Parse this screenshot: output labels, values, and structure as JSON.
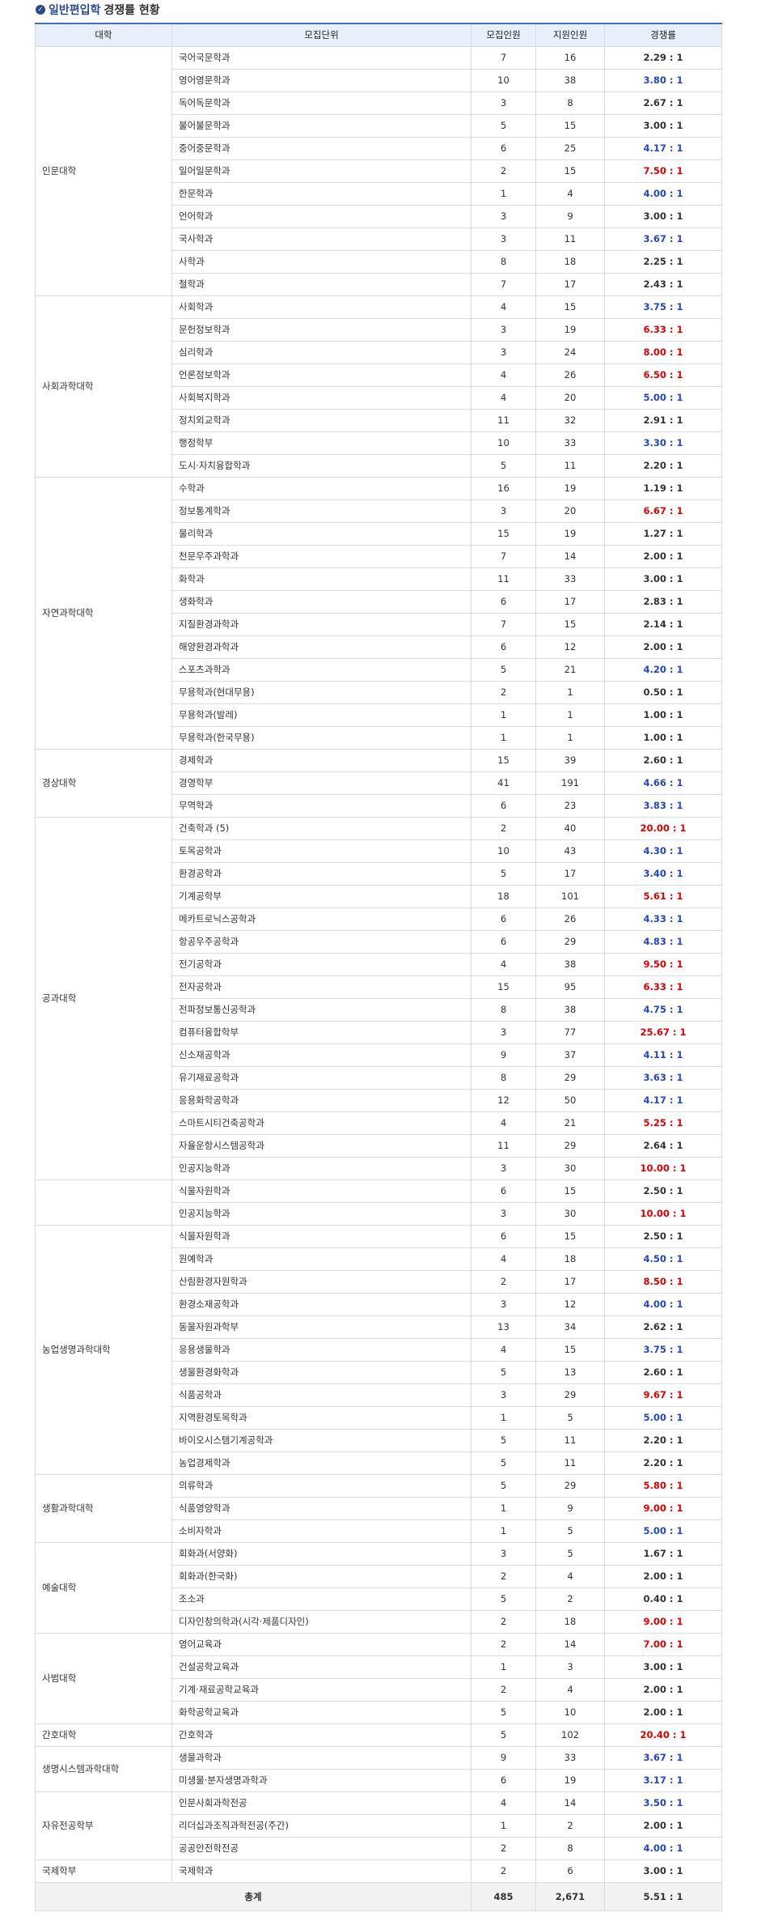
{
  "title": {
    "icon": "check-circle-icon",
    "part1": "일반편입학",
    "part2": "경쟁률 현황"
  },
  "headers": [
    "대학",
    "모집단위",
    "모집인원",
    "지원인원",
    "경쟁률"
  ],
  "colors": {
    "normal": "#222222",
    "blue": "#2246c7",
    "red": "#e00000",
    "header_bg": "#e8effa",
    "header_border": "#3f6fc4"
  },
  "groups": [
    {
      "college": "인문대학",
      "rows": [
        [
          "국어국문학과",
          "7",
          "16",
          "2.29 : 1",
          "normal"
        ],
        [
          "영어영문학과",
          "10",
          "38",
          "3.80 : 1",
          "blue"
        ],
        [
          "독어독문학과",
          "3",
          "8",
          "2.67 : 1",
          "normal"
        ],
        [
          "불어불문학과",
          "5",
          "15",
          "3.00 : 1",
          "normal"
        ],
        [
          "중어중문학과",
          "6",
          "25",
          "4.17 : 1",
          "blue"
        ],
        [
          "일어일문학과",
          "2",
          "15",
          "7.50 : 1",
          "red"
        ],
        [
          "한문학과",
          "1",
          "4",
          "4.00 : 1",
          "blue"
        ],
        [
          "언어학과",
          "3",
          "9",
          "3.00 : 1",
          "normal"
        ],
        [
          "국사학과",
          "3",
          "11",
          "3.67 : 1",
          "blue"
        ],
        [
          "사학과",
          "8",
          "18",
          "2.25 : 1",
          "normal"
        ],
        [
          "철학과",
          "7",
          "17",
          "2.43 : 1",
          "normal"
        ]
      ]
    },
    {
      "college": "사회과학대학",
      "rows": [
        [
          "사회학과",
          "4",
          "15",
          "3.75 : 1",
          "blue"
        ],
        [
          "문헌정보학과",
          "3",
          "19",
          "6.33 : 1",
          "red"
        ],
        [
          "심리학과",
          "3",
          "24",
          "8.00 : 1",
          "red"
        ],
        [
          "언론정보학과",
          "4",
          "26",
          "6.50 : 1",
          "red"
        ],
        [
          "사회복지학과",
          "4",
          "20",
          "5.00 : 1",
          "blue"
        ],
        [
          "정치외교학과",
          "11",
          "32",
          "2.91 : 1",
          "normal"
        ],
        [
          "행정학부",
          "10",
          "33",
          "3.30 : 1",
          "blue"
        ],
        [
          "도시·자치융합학과",
          "5",
          "11",
          "2.20 : 1",
          "normal"
        ]
      ]
    },
    {
      "college": "자연과학대학",
      "rows": [
        [
          "수학과",
          "16",
          "19",
          "1.19 : 1",
          "normal"
        ],
        [
          "정보통계학과",
          "3",
          "20",
          "6.67 : 1",
          "red"
        ],
        [
          "물리학과",
          "15",
          "19",
          "1.27 : 1",
          "normal"
        ],
        [
          "천문우주과학과",
          "7",
          "14",
          "2.00 : 1",
          "normal"
        ],
        [
          "화학과",
          "11",
          "33",
          "3.00 : 1",
          "normal"
        ],
        [
          "생화학과",
          "6",
          "17",
          "2.83 : 1",
          "normal"
        ],
        [
          "지질환경과학과",
          "7",
          "15",
          "2.14 : 1",
          "normal"
        ],
        [
          "해양환경과학과",
          "6",
          "12",
          "2.00 : 1",
          "normal"
        ],
        [
          "스포츠과학과",
          "5",
          "21",
          "4.20 : 1",
          "blue"
        ],
        [
          "무용학과(현대무용)",
          "2",
          "1",
          "0.50 : 1",
          "normal"
        ],
        [
          "무용학과(발레)",
          "1",
          "1",
          "1.00 : 1",
          "normal"
        ],
        [
          "무용학과(한국무용)",
          "1",
          "1",
          "1.00 : 1",
          "normal"
        ]
      ]
    },
    {
      "college": "경상대학",
      "rows": [
        [
          "경제학과",
          "15",
          "39",
          "2.60 : 1",
          "normal"
        ],
        [
          "경영학부",
          "41",
          "191",
          "4.66 : 1",
          "blue"
        ],
        [
          "무역학과",
          "6",
          "23",
          "3.83 : 1",
          "blue"
        ]
      ]
    },
    {
      "college": "공과대학",
      "rows": [
        [
          "건축학과 (5)",
          "2",
          "40",
          "20.00 : 1",
          "red"
        ],
        [
          "토목공학과",
          "10",
          "43",
          "4.30 : 1",
          "blue"
        ],
        [
          "환경공학과",
          "5",
          "17",
          "3.40 : 1",
          "blue"
        ],
        [
          "기계공학부",
          "18",
          "101",
          "5.61 : 1",
          "red"
        ],
        [
          "메카트로닉스공학과",
          "6",
          "26",
          "4.33 : 1",
          "blue"
        ],
        [
          "항공우주공학과",
          "6",
          "29",
          "4.83 : 1",
          "blue"
        ],
        [
          "전기공학과",
          "4",
          "38",
          "9.50 : 1",
          "red"
        ],
        [
          "전자공학과",
          "15",
          "95",
          "6.33 : 1",
          "red"
        ],
        [
          "전파정보통신공학과",
          "8",
          "38",
          "4.75 : 1",
          "blue"
        ],
        [
          "컴퓨터융합학부",
          "3",
          "77",
          "25.67 : 1",
          "red"
        ],
        [
          "신소재공학과",
          "9",
          "37",
          "4.11 : 1",
          "blue"
        ],
        [
          "유기재료공학과",
          "8",
          "29",
          "3.63 : 1",
          "blue"
        ],
        [
          "응용화학공학과",
          "12",
          "50",
          "4.17 : 1",
          "blue"
        ],
        [
          "스마트시티건축공학과",
          "4",
          "21",
          "5.25 : 1",
          "red"
        ],
        [
          "자율운항시스템공학과",
          "11",
          "29",
          "2.64 : 1",
          "normal"
        ],
        [
          "인공지능학과",
          "3",
          "30",
          "10.00 : 1",
          "red"
        ]
      ]
    },
    {
      "college": "",
      "rows": [
        [
          "식물자원학과",
          "6",
          "15",
          "2.50 : 1",
          "normal"
        ],
        [
          "인공지능학과",
          "3",
          "30",
          "10.00 : 1",
          "red"
        ]
      ]
    },
    {
      "college": "농업생명과학대학",
      "rows": [
        [
          "식물자원학과",
          "6",
          "15",
          "2.50 : 1",
          "normal"
        ],
        [
          "원예학과",
          "4",
          "18",
          "4.50 : 1",
          "blue"
        ],
        [
          "산림환경자원학과",
          "2",
          "17",
          "8.50 : 1",
          "red"
        ],
        [
          "환경소재공학과",
          "3",
          "12",
          "4.00 : 1",
          "blue"
        ],
        [
          "동물자원과학부",
          "13",
          "34",
          "2.62 : 1",
          "normal"
        ],
        [
          "응용생물학과",
          "4",
          "15",
          "3.75 : 1",
          "blue"
        ],
        [
          "생물환경화학과",
          "5",
          "13",
          "2.60 : 1",
          "normal"
        ],
        [
          "식품공학과",
          "3",
          "29",
          "9.67 : 1",
          "red"
        ],
        [
          "지역환경토목학과",
          "1",
          "5",
          "5.00 : 1",
          "blue"
        ],
        [
          "바이오시스템기계공학과",
          "5",
          "11",
          "2.20 : 1",
          "normal"
        ],
        [
          "농업경제학과",
          "5",
          "11",
          "2.20 : 1",
          "normal"
        ]
      ]
    },
    {
      "college": "생활과학대학",
      "rows": [
        [
          "의류학과",
          "5",
          "29",
          "5.80 : 1",
          "red"
        ],
        [
          "식품영양학과",
          "1",
          "9",
          "9.00 : 1",
          "red"
        ],
        [
          "소비자학과",
          "1",
          "5",
          "5.00 : 1",
          "blue"
        ]
      ]
    },
    {
      "college": "예술대학",
      "rows": [
        [
          "회화과(서양화)",
          "3",
          "5",
          "1.67 : 1",
          "normal"
        ],
        [
          "회화과(한국화)",
          "2",
          "4",
          "2.00 : 1",
          "normal"
        ],
        [
          "조소과",
          "5",
          "2",
          "0.40 : 1",
          "normal"
        ],
        [
          "디자인창의학과(시각·제품디자인)",
          "2",
          "18",
          "9.00 : 1",
          "red"
        ]
      ]
    },
    {
      "college": "사범대학",
      "rows": [
        [
          "영어교육과",
          "2",
          "14",
          "7.00 : 1",
          "red"
        ],
        [
          "건설공학교육과",
          "1",
          "3",
          "3.00 : 1",
          "normal"
        ],
        [
          "기계·재료공학교육과",
          "2",
          "4",
          "2.00 : 1",
          "normal"
        ],
        [
          "화학공학교육과",
          "5",
          "10",
          "2.00 : 1",
          "normal"
        ]
      ]
    },
    {
      "college": "간호대학",
      "rows": [
        [
          "간호학과",
          "5",
          "102",
          "20.40 : 1",
          "red"
        ]
      ]
    },
    {
      "college": "생명시스템과학대학",
      "rows": [
        [
          "생물과학과",
          "9",
          "33",
          "3.67 : 1",
          "blue"
        ],
        [
          "미생물·분자생명과학과",
          "6",
          "19",
          "3.17 : 1",
          "blue"
        ]
      ]
    },
    {
      "college": "자유전공학부",
      "rows": [
        [
          "인문사회과학전공",
          "4",
          "14",
          "3.50 : 1",
          "blue"
        ],
        [
          "리더십과조직과학전공(주간)",
          "1",
          "2",
          "2.00 : 1",
          "normal"
        ],
        [
          "공공안전학전공",
          "2",
          "8",
          "4.00 : 1",
          "blue"
        ]
      ]
    },
    {
      "college": "국제학부",
      "rows": [
        [
          "국제학과",
          "2",
          "6",
          "3.00 : 1",
          "normal"
        ]
      ]
    }
  ],
  "total": {
    "label": "총계",
    "recruit": "485",
    "apply": "2,671",
    "ratio": "5.51 : 1"
  }
}
